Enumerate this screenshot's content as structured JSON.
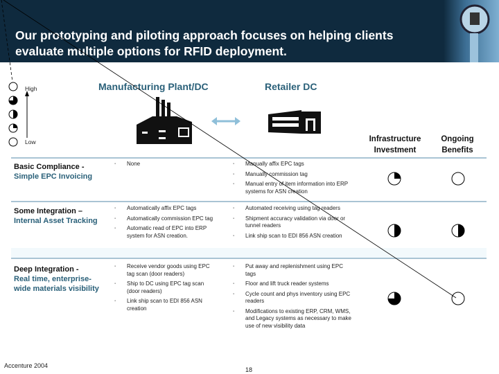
{
  "title": "Our prototyping and piloting approach focuses on helping clients evaluate multiple options for RFID deployment.",
  "legend": {
    "high": "High",
    "low": "Low",
    "levels": [
      0,
      0.75,
      0.5,
      0.25,
      0
    ]
  },
  "sections": {
    "manufacturing": "Manufacturing Plant/DC",
    "retailer": "Retailer DC"
  },
  "columns": {
    "infrastructure": "Infrastructure Investment",
    "ongoing": "Ongoing Benefits"
  },
  "rows": [
    {
      "title": "Basic Compliance -",
      "subtitle": "Simple EPC Invoicing",
      "manufacturing": [
        "None"
      ],
      "retailer": [
        "Manually affix EPC tags",
        "Manually commission tag",
        "Manual entry of item information into ERP systems for ASN creation"
      ],
      "infrastructure_level": 0.25,
      "ongoing_level": 0
    },
    {
      "title": "Some Integration –",
      "subtitle": "Internal Asset Tracking",
      "manufacturing": [
        "Automatically affix EPC tags",
        "Automatically commission EPC tag",
        "Automatic read of EPC into ERP system for ASN creation."
      ],
      "retailer": [
        "Automated receiving using tag readers",
        "Shipment accuracy validation via door or tunnel readers",
        "Link ship scan to EDI 856 ASN creation"
      ],
      "infrastructure_level": 0.5,
      "ongoing_level": 0.5
    },
    {
      "title": "Deep Integration -",
      "subtitle": "Real time, enterprise-wide materials visibility",
      "manufacturing": [
        "Receive vendor goods using EPC tag scan (door readers)",
        "Ship to DC using EPC tag scan (door readers)",
        "Link ship scan to EDI 856 ASN creation"
      ],
      "retailer": [
        "Put away and replenishment using EPC tags",
        "Floor and lift truck reader systems",
        "Cycle count and phys inventory using EPC readers",
        "Modifications to existing ERP, CRM, WMS, and Legacy systems as necessary to make use of new visibility data"
      ],
      "infrastructure_level": 0.75,
      "ongoing_level": 0
    }
  ],
  "footer": {
    "company": "Accenture 2004",
    "page": "18"
  },
  "colors": {
    "header": "#0f2a3e",
    "accent": "#2a6079",
    "rule": "#a9c4d4",
    "arrow": "#8fbfd9"
  }
}
